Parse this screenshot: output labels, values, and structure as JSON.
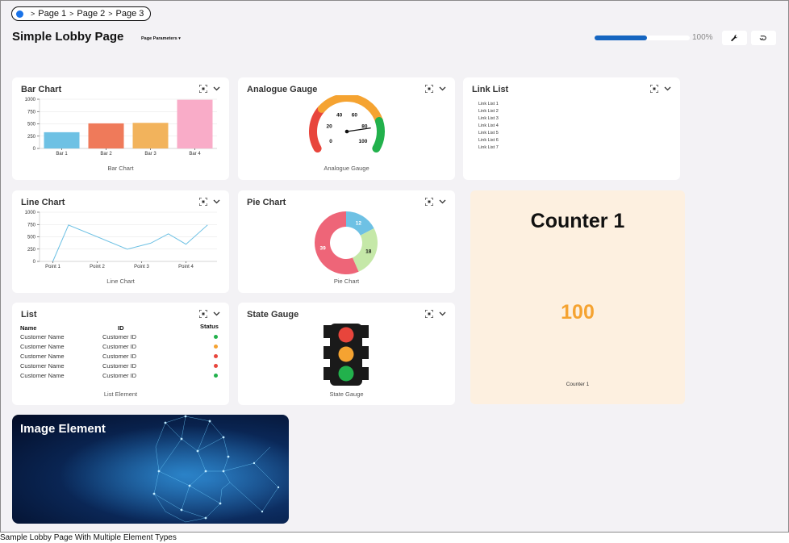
{
  "breadcrumb": {
    "items": [
      "Page 1",
      "Page 2",
      "Page 3"
    ]
  },
  "header": {
    "title": "Simple Lobby Page",
    "params_label": "Page Parameters ▾"
  },
  "progress": {
    "value": 0.55,
    "label": "100%"
  },
  "cards": {
    "bar": {
      "title": "Bar Chart",
      "caption": "Bar Chart"
    },
    "gauge": {
      "title": "Analogue Gauge",
      "caption": "Analogue Gauge"
    },
    "links": {
      "title": "Link List",
      "items": [
        "Link List 1",
        "Link List 2",
        "Link List 3",
        "Link List 4",
        "Link List 5",
        "Link List 6",
        "Link List 7"
      ]
    },
    "line": {
      "title": "Line Chart",
      "caption": "Line Chart"
    },
    "pie": {
      "title": "Pie Chart",
      "caption": "Pie Chart"
    },
    "list": {
      "title": "List",
      "headers": [
        "Name",
        "ID",
        "Status"
      ],
      "rows": [
        {
          "name": "Customer Name",
          "id": "Customer ID",
          "status": "#22b14c"
        },
        {
          "name": "Customer Name",
          "id": "Customer ID",
          "status": "#f5a331"
        },
        {
          "name": "Customer Name",
          "id": "Customer ID",
          "status": "#e8453c"
        },
        {
          "name": "Customer Name",
          "id": "Customer ID",
          "status": "#e8453c"
        },
        {
          "name": "Customer Name",
          "id": "Customer ID",
          "status": "#22b14c"
        }
      ],
      "caption": "List Element"
    },
    "state": {
      "title": "State Gauge",
      "caption": "State Gauge"
    }
  },
  "counter": {
    "title": "Counter 1",
    "value": "100",
    "caption": "Counter 1"
  },
  "image": {
    "title": "Image Element"
  },
  "footer": {
    "caption": "Sample Lobby Page With Multiple Element Types"
  },
  "chart_data": [
    {
      "type": "bar",
      "categories": [
        "Bar 1",
        "Bar 2",
        "Bar 3",
        "Bar 4"
      ],
      "values": [
        330,
        510,
        520,
        990
      ],
      "colors": [
        "#6ec1e4",
        "#ef7a5a",
        "#f2b35c",
        "#f9acc8"
      ],
      "yticks": [
        0,
        250,
        500,
        750,
        1000
      ],
      "ylim": [
        0,
        1000
      ]
    },
    {
      "type": "line",
      "categories": [
        "Point 1",
        "Point 2",
        "Point 3",
        "Point 4"
      ],
      "x": [
        0,
        0.4,
        1.9,
        2.5,
        2.95,
        3.4,
        3.95,
        4.8
      ],
      "values": [
        0,
        740,
        250,
        370,
        560,
        350,
        740
      ],
      "yticks": [
        0,
        250,
        500,
        750,
        1000
      ],
      "ylim": [
        0,
        1000
      ],
      "color": "#6ec1e4"
    },
    {
      "type": "pie",
      "slices": [
        {
          "value": 12,
          "color": "#6ec1e4"
        },
        {
          "value": 18,
          "color": "#c5e8a8"
        },
        {
          "value": 39,
          "color": "#ee6578"
        }
      ]
    },
    {
      "type": "gauge",
      "ticks": [
        0,
        20,
        40,
        60,
        80,
        100
      ],
      "value": 84
    }
  ]
}
